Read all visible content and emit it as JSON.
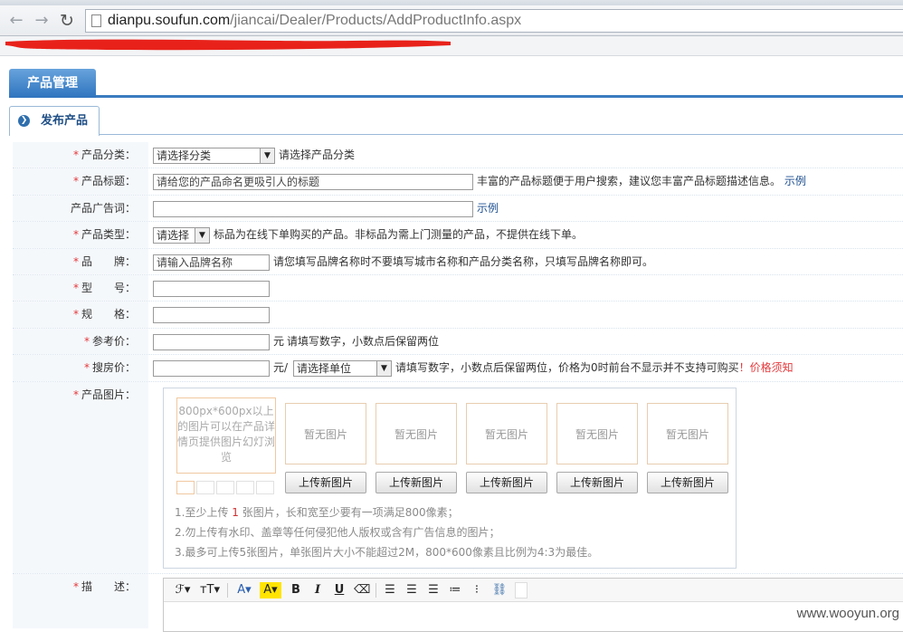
{
  "browser": {
    "url_host": "dianpu.soufun.com",
    "url_path": "/jiancai/Dealer/Products/AddProductInfo.aspx"
  },
  "tabs": {
    "main": "产品管理",
    "sub": "发布产品"
  },
  "form": {
    "category": {
      "label": "产品分类：",
      "select_value": "请选择分类",
      "hint": "请选择产品分类"
    },
    "title": {
      "label": "产品标题：",
      "value": "请给您的产品命名更吸引人的标题",
      "hint": "丰富的产品标题便于用户搜索，建议您丰富产品标题描述信息。",
      "link": "示例"
    },
    "ad_words": {
      "label": "产品广告词：",
      "value": "",
      "link": "示例"
    },
    "type": {
      "label": "产品类型：",
      "select_value": "请选择",
      "hint": "标品为在线下单购买的产品。非标品为需上门测量的产品，不提供在线下单。"
    },
    "brand": {
      "label": "品　　牌：",
      "value": "请输入品牌名称",
      "hint": "请您填写品牌名称时不要填写城市名称和产品分类名称，只填写品牌名称即可。"
    },
    "model": {
      "label": "型　　号：",
      "value": ""
    },
    "spec": {
      "label": "规　　格：",
      "value": ""
    },
    "ref_price": {
      "label": "参考价：",
      "value": "",
      "unit": "元",
      "hint": "请填写数字，小数点后保留两位"
    },
    "soufang_price": {
      "label": "搜房价：",
      "value": "",
      "unit": "元/",
      "select_value": "请选择单位",
      "hint": "请填写数字，小数点后保留两位，价格为0时前台不显示并不支持可购买",
      "exclaim": "！",
      "link": "价格须知"
    },
    "images": {
      "label": "产品图片：",
      "cover_text": "800px*600px以上的图片可以在产品详情页提供图片幻灯浏览",
      "placeholders": [
        "暂无图片",
        "暂无图片",
        "暂无图片",
        "暂无图片",
        "暂无图片"
      ],
      "upload_label": "上传新图片",
      "notes": {
        "line1_prefix": "1.至少上传 ",
        "line1_count": "1",
        "line1_suffix": " 张图片，长和宽至少要有一项满足800像素；",
        "line2": "2.勿上传有水印、盖章等任何侵犯他人版权或含有广告信息的图片；",
        "line3": "3.最多可上传5张图片，单张图片大小不能超过2M，800*600像素且比例为4:3为最佳。"
      }
    },
    "description": {
      "label": "描　　述："
    }
  },
  "editor_toolbar": {
    "font_family": "ℱ▾",
    "font_size": "ᴛT▾",
    "font_color": "A▾",
    "highlight": "A▾",
    "bold": "B",
    "italic": "I",
    "underline": "U",
    "eraser": "⌫"
  },
  "watermark": "www.wooyun.org",
  "colors": {
    "accent": "#3a7cc0",
    "required": "#e4393c",
    "link": "#1d4f91"
  }
}
